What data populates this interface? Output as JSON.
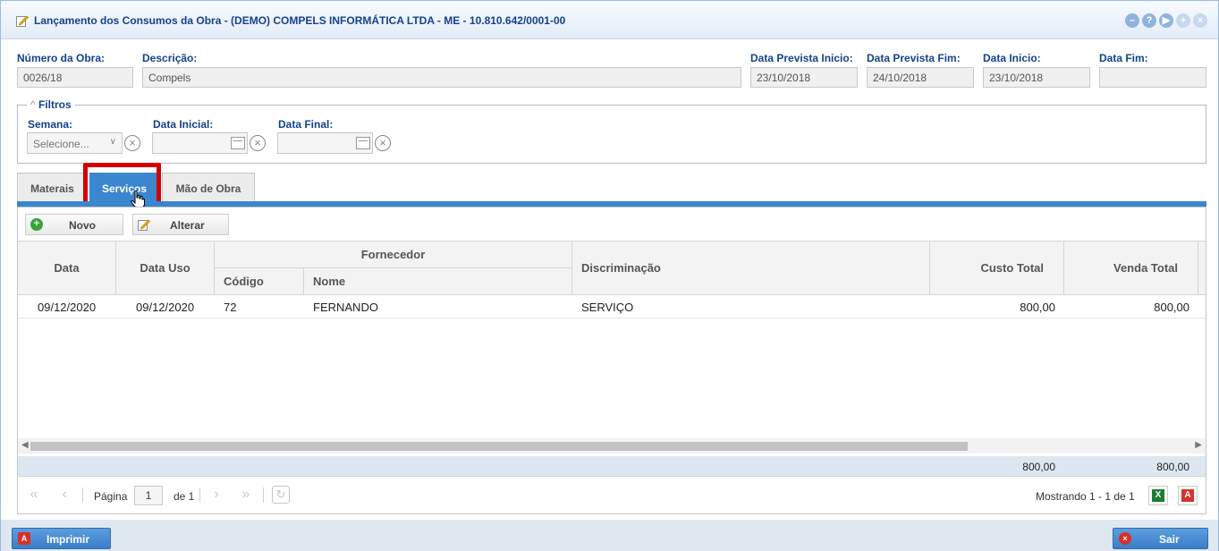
{
  "window": {
    "title": "Lançamento dos Consumos da Obra - (DEMO) COMPELS INFORMÁTICA LTDA - ME - 10.810.642/0001-00",
    "tools": [
      "minimize-icon",
      "help-icon",
      "next-icon",
      "move-icon",
      "close-icon"
    ],
    "tool_glyphs": {
      "help": "?",
      "next": "▶",
      "move": "+",
      "close": "×"
    }
  },
  "header_fields": {
    "numero_obra": {
      "label": "Número da Obra:",
      "value": "0026/18"
    },
    "descricao": {
      "label": "Descrição:",
      "value": "Compels"
    },
    "data_prevista_inicio": {
      "label": "Data Prevista Inicio:",
      "value": "23/10/2018"
    },
    "data_prevista_fim": {
      "label": "Data Prevista Fim:",
      "value": "24/10/2018"
    },
    "data_inicio": {
      "label": "Data Inicio:",
      "value": "23/10/2018"
    },
    "data_fim": {
      "label": "Data Fim:",
      "value": ""
    }
  },
  "filtros": {
    "legend": "Filtros",
    "semana": {
      "label": "Semana:",
      "placeholder": "Selecione..."
    },
    "data_inicial": {
      "label": "Data Inicial:",
      "value": ""
    },
    "data_final": {
      "label": "Data Final:",
      "value": ""
    }
  },
  "tabs": [
    {
      "label": "Materais",
      "active": false
    },
    {
      "label": "Serviços",
      "active": true
    },
    {
      "label": "Mão de Obra",
      "active": false
    }
  ],
  "toolbar": {
    "novo_label": "Novo",
    "alterar_label": "Alterar"
  },
  "grid": {
    "headers": {
      "data": "Data",
      "data_uso": "Data Uso",
      "fornecedor": "Fornecedor",
      "codigo": "Código",
      "nome": "Nome",
      "discriminacao": "Discriminação",
      "custo_total": "Custo Total",
      "venda_total": "Venda Total"
    },
    "rows": [
      {
        "data": "09/12/2020",
        "data_uso": "09/12/2020",
        "codigo": "72",
        "nome": "FERNANDO",
        "discriminacao": "SERVIÇO",
        "custo_total": "800,00",
        "venda_total": "800,00"
      }
    ],
    "summary": {
      "custo_total": "800,00",
      "venda_total": "800,00"
    }
  },
  "pager": {
    "page_label": "Página",
    "page_value": "1",
    "of_label": "de 1",
    "showing": "Mostrando 1 - 1 de 1"
  },
  "footer": {
    "imprimir_label": "Imprimir",
    "sair_label": "Sair"
  },
  "colors": {
    "accent": "#3a86cf",
    "title": "#15428b",
    "highlight": "#d40000"
  }
}
